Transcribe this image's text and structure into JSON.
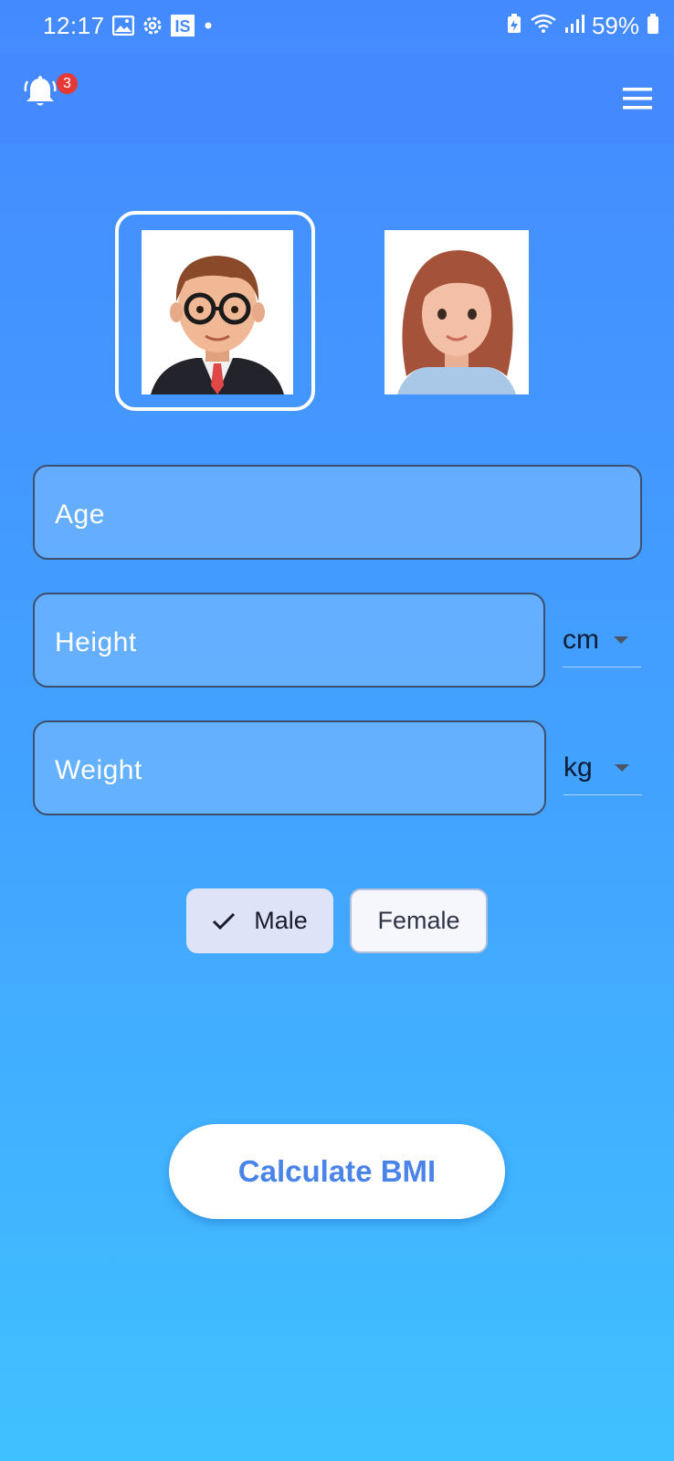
{
  "status_bar": {
    "time": "12:17",
    "battery": "59%",
    "left_icons": [
      "gallery-icon",
      "settings-icon",
      "app-is-icon",
      "dot-icon"
    ],
    "right_icons": [
      "battery-saver-icon",
      "wifi-icon",
      "signal-icon",
      "battery-icon"
    ]
  },
  "app_bar": {
    "notification_count": "3",
    "menu_icon": "hamburger-menu-icon",
    "notification_icon": "bell-icon"
  },
  "avatars": {
    "selected": "male",
    "items": [
      {
        "id": "male",
        "icon": "male-avatar-icon"
      },
      {
        "id": "female",
        "icon": "female-avatar-icon"
      }
    ]
  },
  "form": {
    "age_label": "Age",
    "height_label": "Height",
    "weight_label": "Weight",
    "height_unit": "cm",
    "weight_unit": "kg"
  },
  "gender": {
    "male_label": "Male",
    "female_label": "Female",
    "selected": "Male"
  },
  "calculate_label": "Calculate BMI",
  "colors": {
    "background_top": "#448aff",
    "background_bottom": "#40c1ff",
    "app_bar": "#4589ff",
    "accent_text": "#4a84e8",
    "badge": "#e53935"
  }
}
